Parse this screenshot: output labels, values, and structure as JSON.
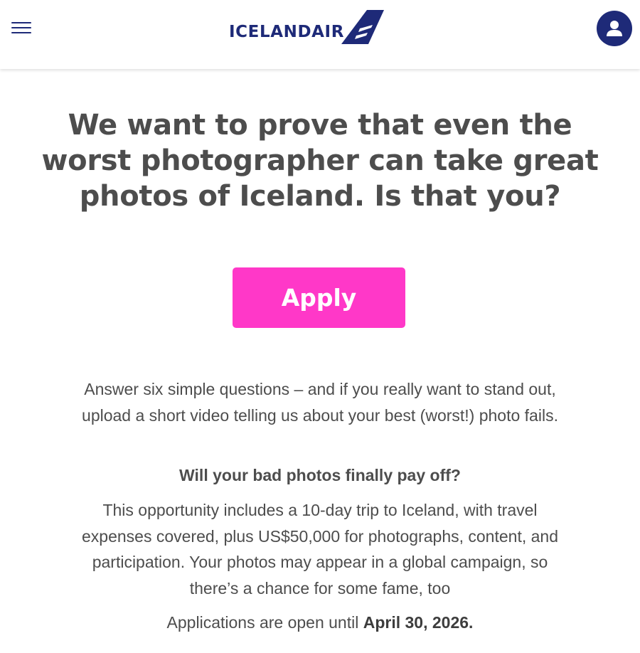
{
  "header": {
    "menu_icon": "hamburger-menu-icon",
    "logo_text": "ICELANDAIR",
    "logo_mark_icon": "icelandair-wing-icon",
    "account_icon": "user-account-icon",
    "brand_color": "#1e2a78"
  },
  "main": {
    "headline": "We want to prove that even the worst photographer can take great photos of Iceland. Is that you?",
    "apply_label": "Apply",
    "apply_color": "#ff38c8",
    "intro": "Answer six simple questions – and if you really want to stand out, upload a short video telling us about your best (worst!) photo fails.",
    "subhead": "Will your bad photos finally pay off?",
    "details": "This opportunity includes a 10-day trip to Iceland, with travel expenses covered, plus US$50,000 for photographs, content, and participation. Your photos may appear in a global campaign, so there’s a chance for some fame, too",
    "deadline_prefix": "Applications are open until ",
    "deadline_date": "April 30, 2026."
  }
}
